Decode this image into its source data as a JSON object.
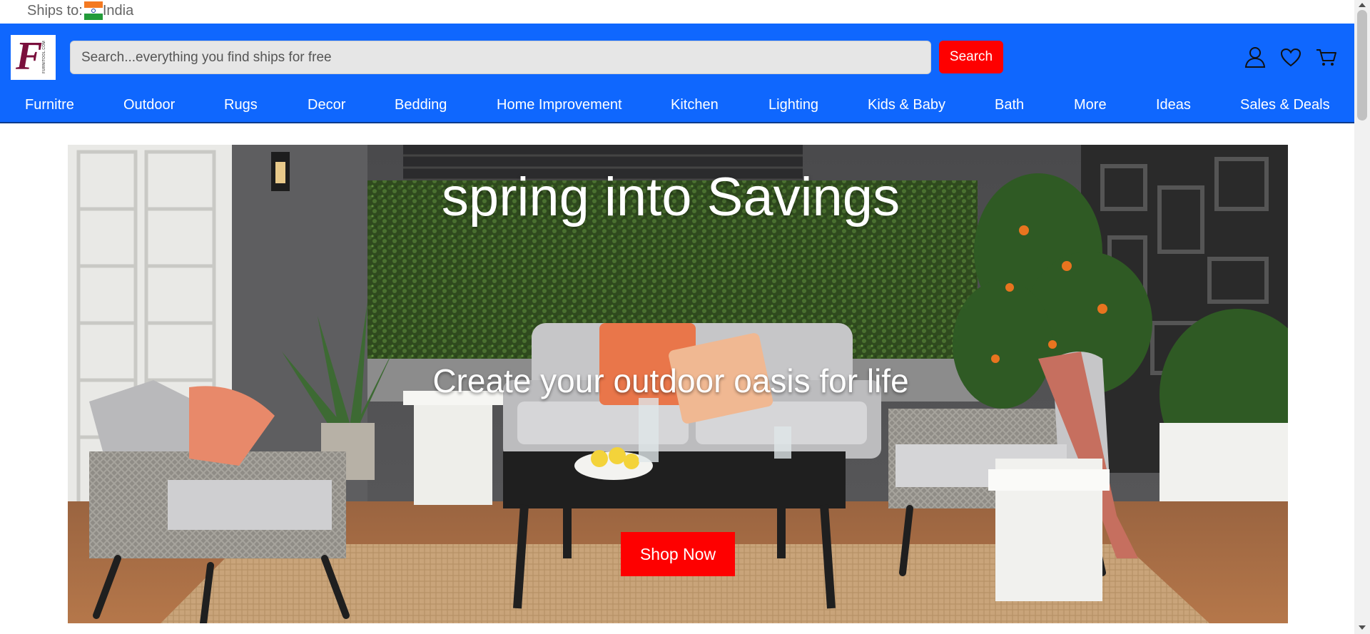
{
  "ships": {
    "label": "Ships to:",
    "country": "India",
    "flag_icon": "india-flag-icon"
  },
  "header": {
    "logo_letter": "F",
    "logo_text": "FURNITOOL.COM",
    "search_placeholder": "Search...everything you find ships for free",
    "search_button": "Search",
    "icons": [
      "user-icon",
      "heart-icon",
      "cart-icon"
    ]
  },
  "nav": {
    "items": [
      "Furnitre",
      "Outdoor",
      "Rugs",
      "Decor",
      "Bedding",
      "Home Improvement",
      "Kitchen",
      "Lighting",
      "Kids & Baby",
      "Bath",
      "More",
      "Ideas",
      "Sales & Deals"
    ]
  },
  "hero": {
    "title": "spring into Savings",
    "subtitle": "Create your outdoor oasis for life",
    "cta": "Shop Now"
  },
  "colors": {
    "header_blue": "#0f67fe",
    "search_button_red": "#fe0000",
    "cta_red": "#fe0000",
    "logo_maroon": "#7a0f3c"
  }
}
